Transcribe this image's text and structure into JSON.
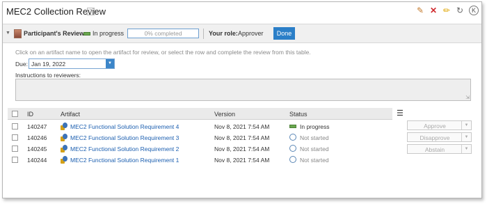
{
  "window": {
    "title": "MEC2 Collection Review",
    "help": "?"
  },
  "toolbar_icons": [
    "review-icon",
    "delete-icon",
    "edit-icon",
    "refresh-icon",
    "close-icon"
  ],
  "review": {
    "participant_label": "Participant's Review:",
    "state": "In progress",
    "progress_text": "0% completed",
    "progress_fraction": 0,
    "role_label": "Your role:",
    "role_value": "Approver",
    "done_label": "Done"
  },
  "instructions_text": "Click on an artifact name to open the artifact for review, or select the row and complete the review from this table.",
  "due": {
    "label": "Due:",
    "value": "Jan 19, 2022"
  },
  "reviewer_instructions_label": "Instructions to reviewers:",
  "table": {
    "headers": {
      "id": "ID",
      "artifact": "Artifact",
      "version": "Version",
      "status": "Status"
    },
    "rows": [
      {
        "id": "140247",
        "artifact": "MEC2 Functional Solution Requirement 4",
        "version": "Nov 8, 2021 7:54 AM",
        "status": "In progress"
      },
      {
        "id": "140246",
        "artifact": "MEC2 Functional Solution Requirement 3",
        "version": "Nov 8, 2021 7:54 AM",
        "status": "Not started"
      },
      {
        "id": "140245",
        "artifact": "MEC2 Functional Solution Requirement 2",
        "version": "Nov 8, 2021 7:54 AM",
        "status": "Not started"
      },
      {
        "id": "140244",
        "artifact": "MEC2 Functional Solution Requirement 1",
        "version": "Nov 8, 2021 7:54 AM",
        "status": "Not started"
      }
    ]
  },
  "side_actions": {
    "approve": "Approve",
    "disapprove": "Disapprove",
    "abstain": "Abstain"
  },
  "colors": {
    "primary_button": "#2b7fc8",
    "link": "#1c5fb0",
    "in_progress": "#6aa84f"
  }
}
